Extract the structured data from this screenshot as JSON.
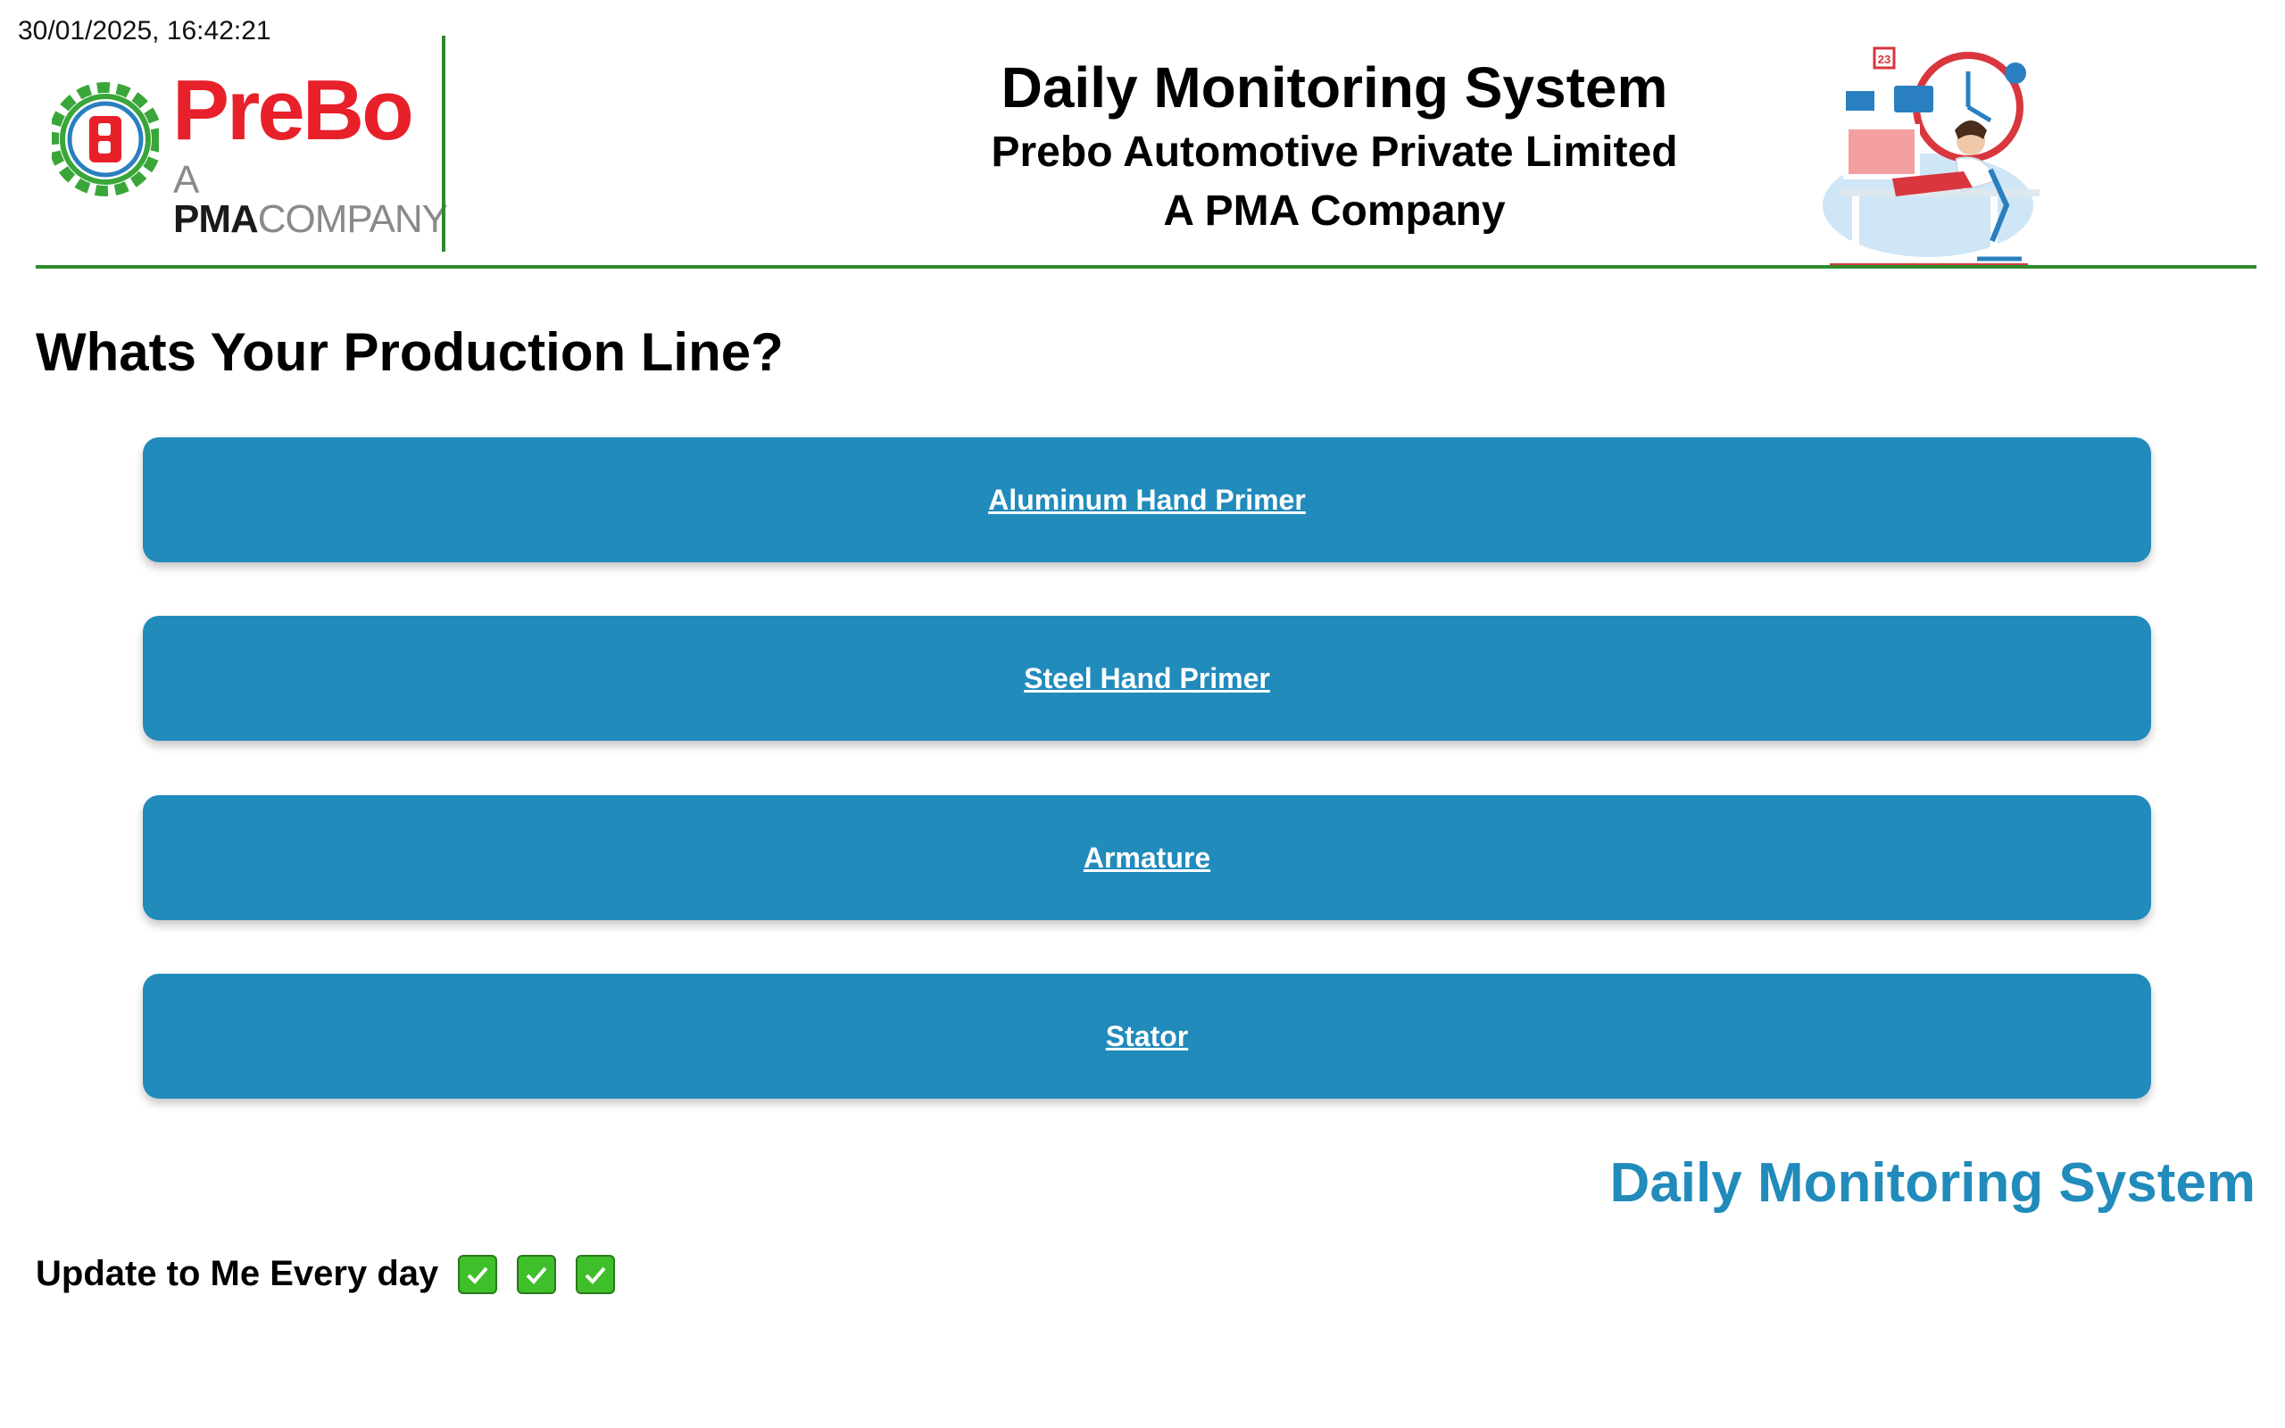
{
  "header": {
    "timestamp": "30/01/2025, 16:42:21",
    "logo": {
      "brand": "PreBo",
      "tag_a": "A",
      "tag_pma": "PMA",
      "tag_company": "COMPANY",
      "icon": "prebo-gear-logo-icon"
    },
    "title": "Daily Monitoring System",
    "company": "Prebo Automotive Private Limited",
    "subtitle": "A PMA Company",
    "illustration_icon": "person-working-clock-illustration-icon",
    "illustration_calendar_number": "23"
  },
  "main": {
    "question": "Whats Your Production Line?",
    "lines": [
      {
        "label": "Aluminum Hand Primer"
      },
      {
        "label": "Steel Hand Primer"
      },
      {
        "label": "Armature"
      },
      {
        "label": "Stator"
      }
    ]
  },
  "footer": {
    "brand": "Daily Monitoring System",
    "update_text": "Update to Me Every day",
    "checks": [
      "check-mark-icon",
      "check-mark-icon",
      "check-mark-icon"
    ]
  },
  "colors": {
    "accent": "#218bbb",
    "divider_green": "#2e8b2e",
    "logo_red": "#e8202a",
    "check_green": "#3fbf2a"
  }
}
